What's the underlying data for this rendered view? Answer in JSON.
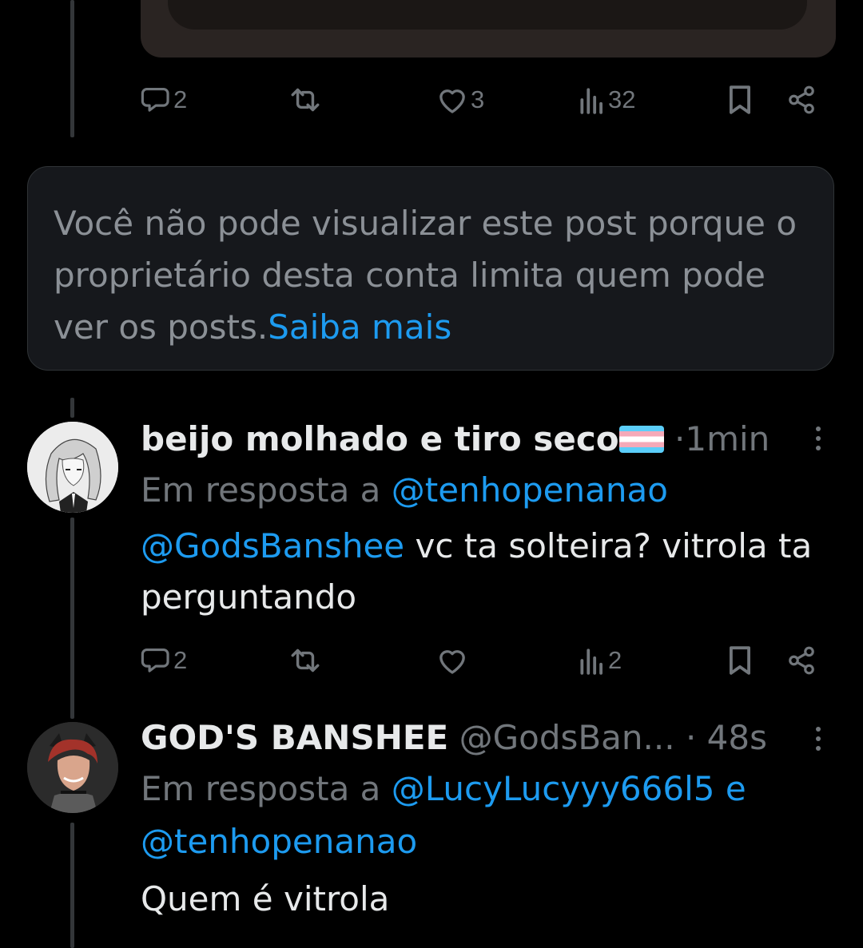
{
  "previous_post": {
    "actions": {
      "reply_count": "2",
      "repost_count": "",
      "like_count": "3",
      "views_count": "32"
    }
  },
  "notice": {
    "message": "Você não pode visualizar este post porque o proprietário desta conta limita quem pode ver os posts.",
    "link": "Saiba mais"
  },
  "reply1": {
    "display_name": "beijo molhado e tiro seco",
    "flag_icon": "transgender-flag",
    "separator": "·",
    "time": "1min",
    "in_reply_prefix": "Em resposta a",
    "in_reply_handle": "@tenhopenanao",
    "mention": "@GodsBanshee",
    "body_line1": " vc ta solteira? vitrola ta",
    "body_line2": "perguntando",
    "actions": {
      "reply_count": "2",
      "repost_count": "",
      "like_count": "",
      "views_count": "2"
    }
  },
  "reply2": {
    "display_name": "GOD'S BANSHEE",
    "handle": "@GodsBan...",
    "separator": "·",
    "time": "48s",
    "in_reply_prefix": "Em resposta a",
    "in_reply_handle1": "@LucyLucyyy666l5",
    "in_reply_connector": "e",
    "in_reply_handle2": "@tenhopenanao",
    "body": "Quem é vitrola"
  },
  "colors": {
    "background": "#000000",
    "link": "#1d9bf0",
    "muted": "#71767b",
    "text": "#e7e9ea"
  }
}
